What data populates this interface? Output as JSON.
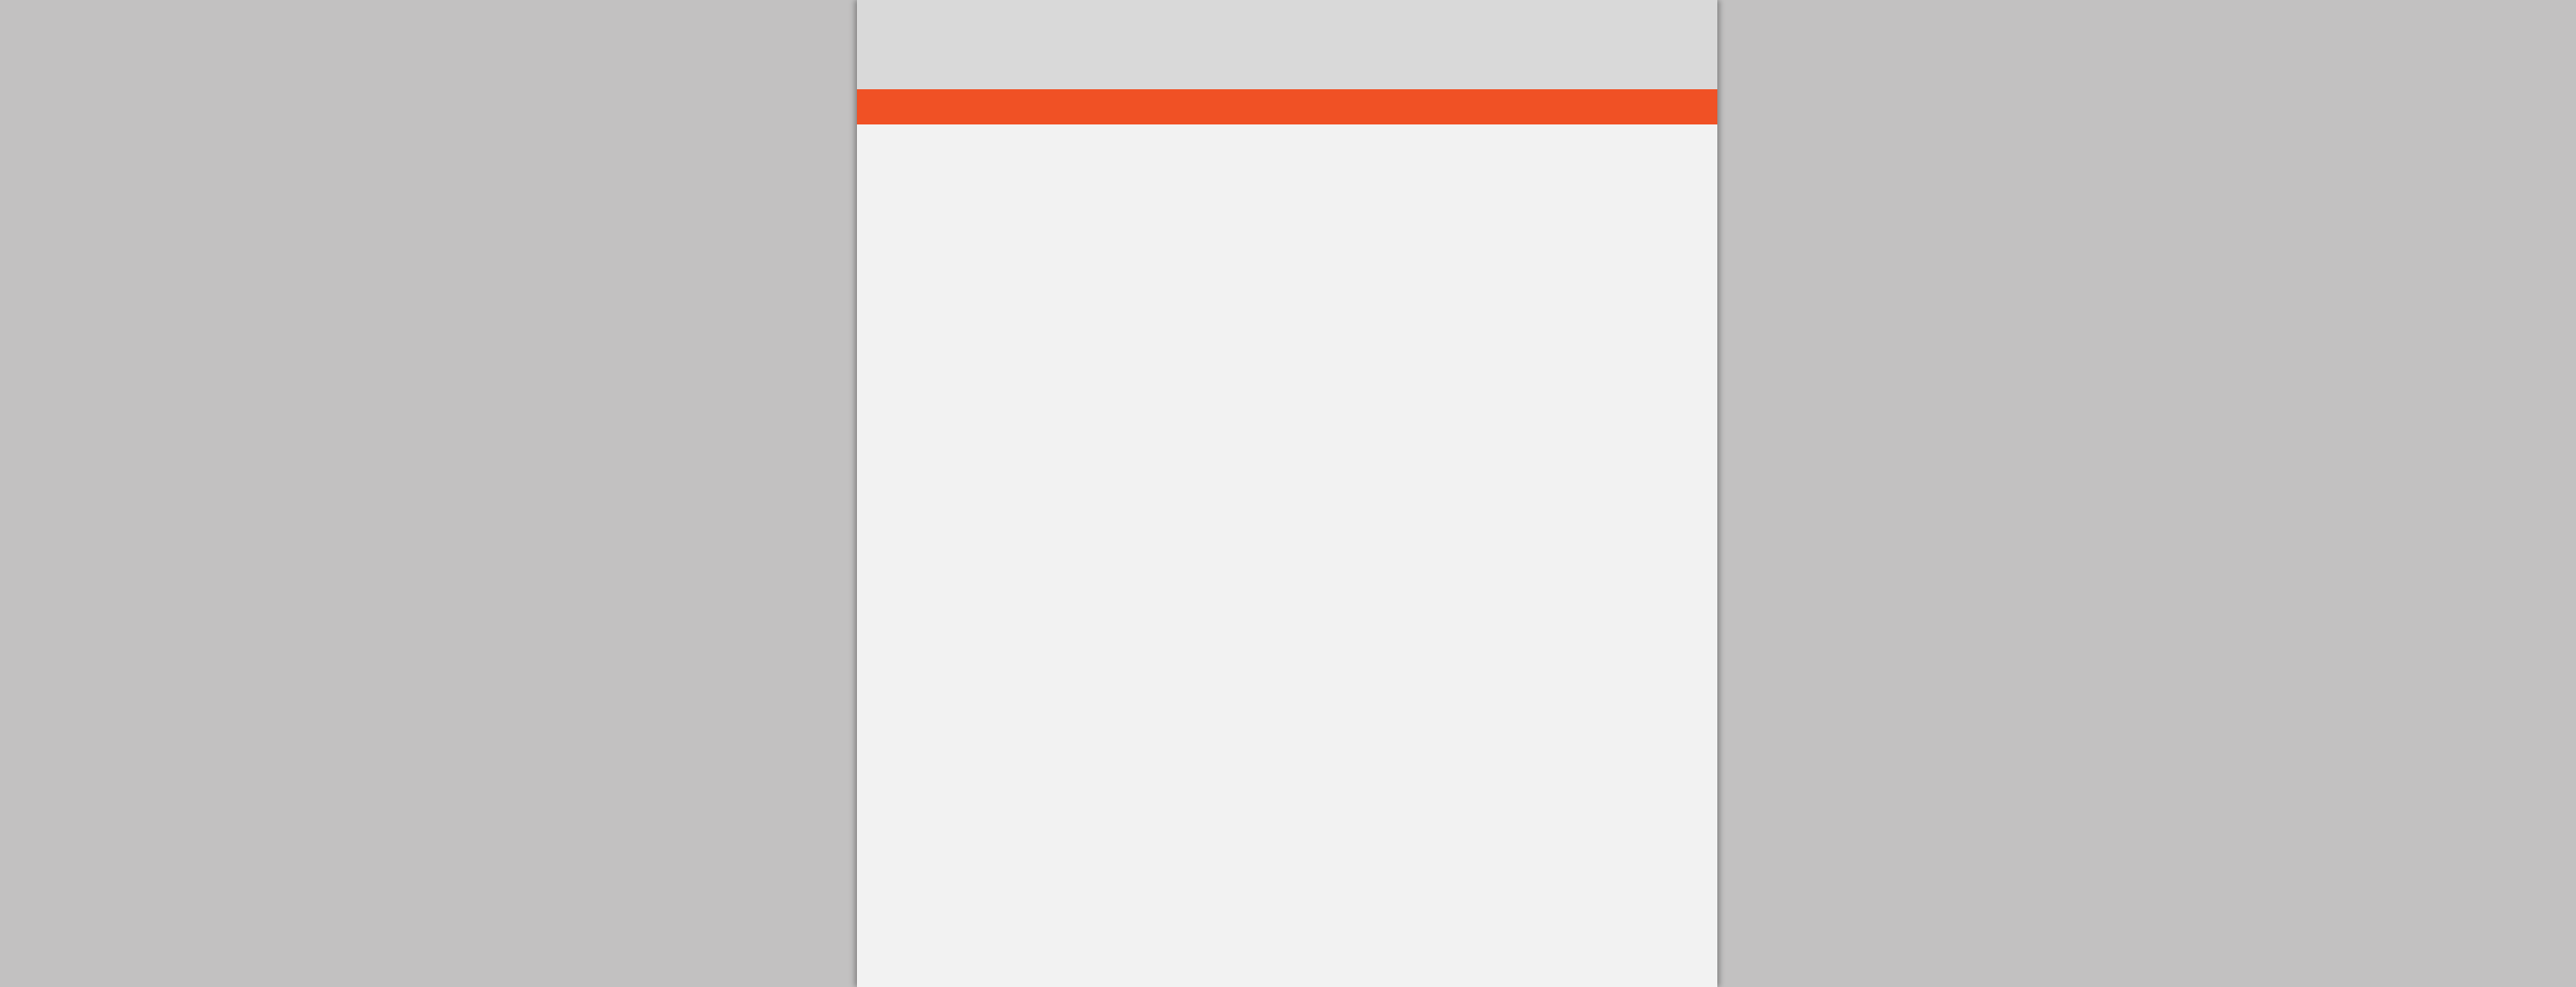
{
  "colors": {
    "backdrop": "#c2c1c1",
    "title_bar": "#d9d9d9",
    "accent": "#f05125",
    "content": "#f2f2f2"
  }
}
